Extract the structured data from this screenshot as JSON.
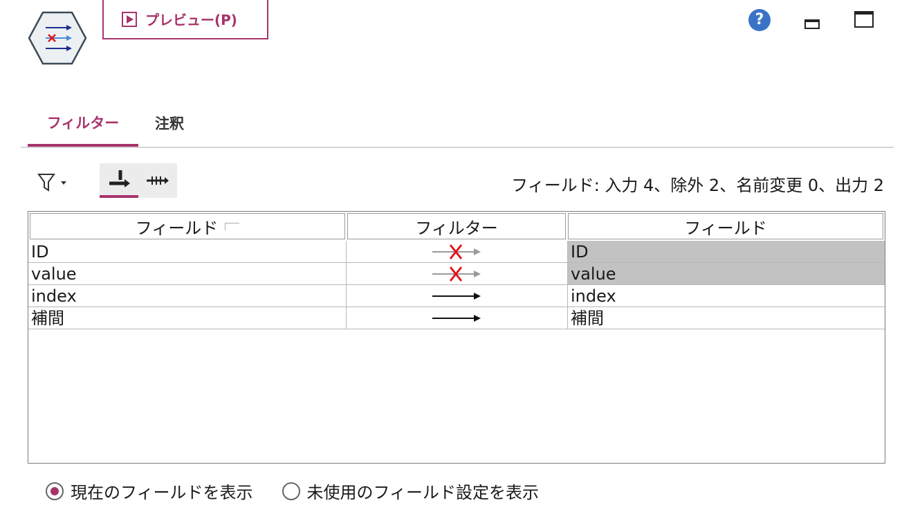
{
  "toolbar": {
    "preview_label": "プレビュー(P)"
  },
  "tabs": [
    {
      "label": "フィルター",
      "active": true
    },
    {
      "label": "注釈",
      "active": false
    }
  ],
  "field_summary": "フィールド: 入力 4、除外 2、名前変更 0、出力 2",
  "table": {
    "headers": [
      "フィールド",
      "フィルター",
      "フィールド"
    ],
    "rows": [
      {
        "input": "ID",
        "filter": "excluded",
        "output": "ID"
      },
      {
        "input": "value",
        "filter": "excluded",
        "output": "value"
      },
      {
        "input": "index",
        "filter": "pass",
        "output": "index"
      },
      {
        "input": "補間",
        "filter": "pass",
        "output": "補間"
      }
    ]
  },
  "view_options": [
    {
      "label": "現在のフィールドを表示",
      "selected": true
    },
    {
      "label": "未使用のフィールド設定を表示",
      "selected": false
    }
  ],
  "icons": {
    "node": "filter-node-icon",
    "help": "help-icon",
    "minimize": "minimize-icon",
    "maximize": "maximize-icon",
    "funnel": "funnel-filter-icon",
    "tool1": "remove-fields-icon",
    "tool2": "pass-all-fields-icon"
  },
  "colors": {
    "accent": "#a8336b",
    "help": "#3a73c6",
    "excluded_row": "#c2c2c2",
    "cross": "#e0151c"
  }
}
